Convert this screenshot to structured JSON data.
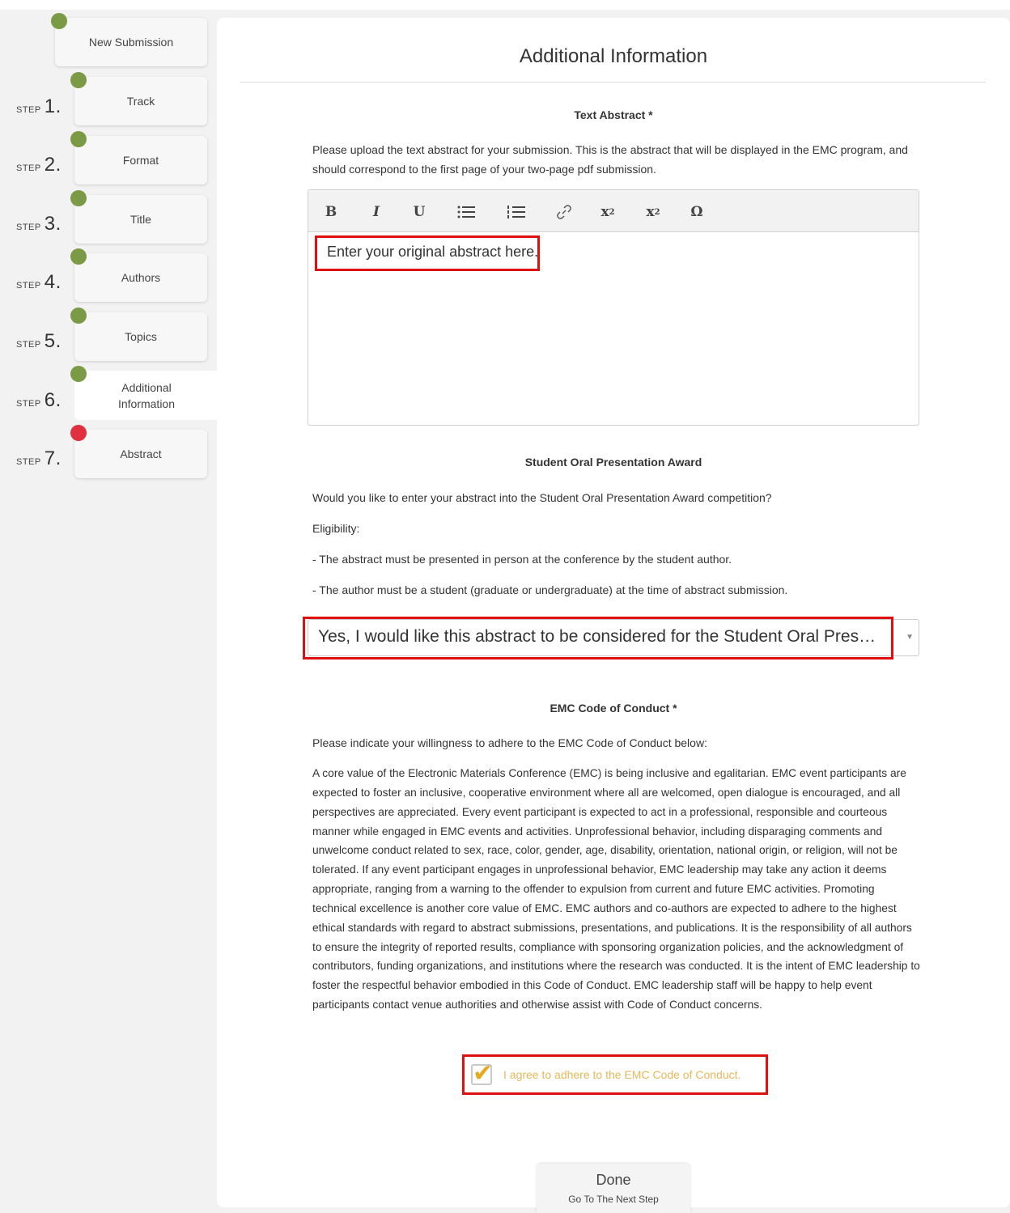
{
  "sidebar": {
    "step_word": "STEP",
    "new_submission": "New Submission",
    "steps": [
      {
        "num": "1.",
        "label": "Track"
      },
      {
        "num": "2.",
        "label": "Format"
      },
      {
        "num": "3.",
        "label": "Title"
      },
      {
        "num": "4.",
        "label": "Authors"
      },
      {
        "num": "5.",
        "label": "Topics"
      },
      {
        "num": "6.",
        "label_line1": "Additional",
        "label_line2": "Information"
      },
      {
        "num": "7.",
        "label": "Abstract"
      }
    ],
    "colors": {
      "complete": "#7a9a45",
      "incomplete": "#e03040"
    }
  },
  "main": {
    "title": "Additional Information",
    "text_abstract": {
      "title": "Text Abstract *",
      "description": "Please upload the text abstract for your submission. This is the abstract that will be displayed in the EMC program, and should correspond to the first page of your two-page pdf submission.",
      "toolbar": {
        "bold": "B",
        "italic": "I",
        "underline": "U",
        "bullet_list": "☰",
        "numbered_list": "☷",
        "link": "🔗",
        "superscript": "x",
        "subscript": "x",
        "special_char": "Ω"
      },
      "content": "Enter your original abstract here."
    },
    "student_award": {
      "title": "Student Oral Presentation Award",
      "question": "Would you like to enter your abstract into the Student Oral Presentation Award competition?",
      "eligibility": "Eligibility:",
      "rule1": "- The abstract must be presented in person at the conference by the student author.",
      "rule2": "- The author must be a student (graduate or undergraduate) at the time of abstract submission.",
      "selected": "Yes, I would like this abstract to be considered for the Student Oral Presentation Award"
    },
    "code_of_conduct": {
      "title": "EMC Code of Conduct *",
      "instruction": "Please indicate your willingness to adhere to the EMC Code of Conduct below:",
      "body": "A core value of the Electronic Materials Conference (EMC) is being inclusive and egalitarian. EMC event participants are expected to foster an inclusive, cooperative environment where all are welcomed, open dialogue is encouraged, and all perspectives are appreciated. Every event participant is expected to act in a professional, responsible and courteous manner while engaged in EMC events and activities. Unprofessional behavior, including disparaging comments and unwelcome conduct related to sex, race, color, gender, age, disability, orientation, national origin, or religion, will not be tolerated. If any event participant engages in unprofessional behavior, EMC leadership may take any action it deems appropriate, ranging from a warning to the offender to expulsion from current and future EMC activities. Promoting technical excellence is another core value of EMC. EMC authors and co-authors are expected to adhere to the highest ethical standards with regard to abstract submissions, presentations, and publications. It is the responsibility of all authors to ensure the integrity of reported results, compliance with sponsoring organization policies, and the acknowledgment of contributors, funding organizations, and institutions where the research was conducted. It is the intent of EMC leadership to foster the respectful behavior embodied in this Code of Conduct. EMC leadership staff will be happy to help event participants contact venue authorities and otherwise assist with Code of Conduct concerns.",
      "agree_label": "I agree to adhere to the EMC Code of Conduct.",
      "agree_checked": true
    },
    "done_button": {
      "label": "Done",
      "sublabel": "Go To The Next Step"
    }
  }
}
